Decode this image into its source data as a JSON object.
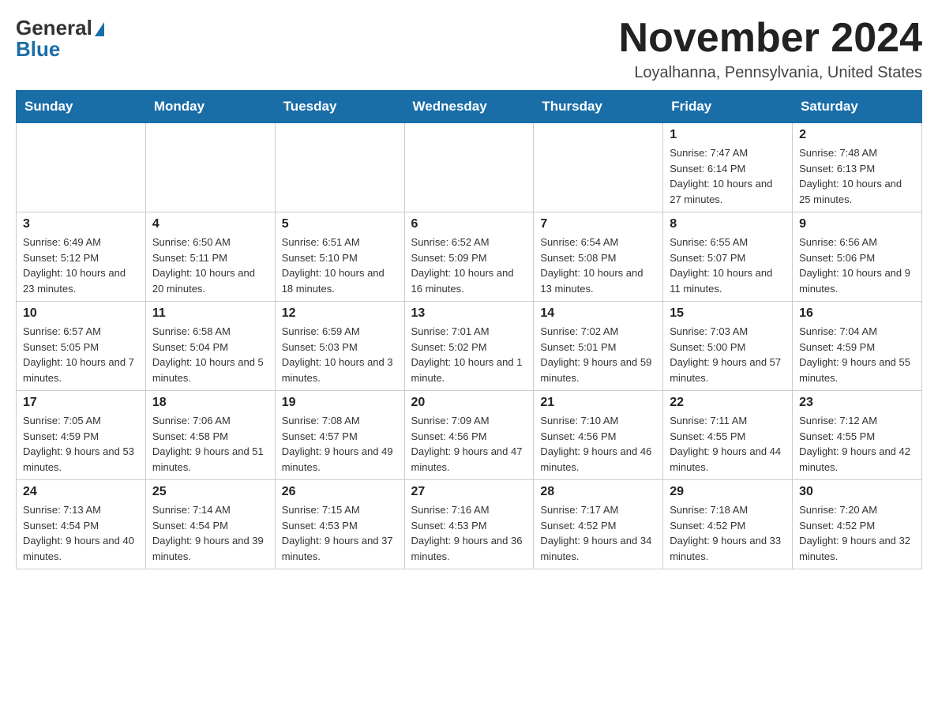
{
  "logo": {
    "general": "General",
    "blue": "Blue"
  },
  "title": "November 2024",
  "location": "Loyalhanna, Pennsylvania, United States",
  "days_of_week": [
    "Sunday",
    "Monday",
    "Tuesday",
    "Wednesday",
    "Thursday",
    "Friday",
    "Saturday"
  ],
  "weeks": [
    [
      {
        "day": "",
        "info": ""
      },
      {
        "day": "",
        "info": ""
      },
      {
        "day": "",
        "info": ""
      },
      {
        "day": "",
        "info": ""
      },
      {
        "day": "",
        "info": ""
      },
      {
        "day": "1",
        "info": "Sunrise: 7:47 AM\nSunset: 6:14 PM\nDaylight: 10 hours and 27 minutes."
      },
      {
        "day": "2",
        "info": "Sunrise: 7:48 AM\nSunset: 6:13 PM\nDaylight: 10 hours and 25 minutes."
      }
    ],
    [
      {
        "day": "3",
        "info": "Sunrise: 6:49 AM\nSunset: 5:12 PM\nDaylight: 10 hours and 23 minutes."
      },
      {
        "day": "4",
        "info": "Sunrise: 6:50 AM\nSunset: 5:11 PM\nDaylight: 10 hours and 20 minutes."
      },
      {
        "day": "5",
        "info": "Sunrise: 6:51 AM\nSunset: 5:10 PM\nDaylight: 10 hours and 18 minutes."
      },
      {
        "day": "6",
        "info": "Sunrise: 6:52 AM\nSunset: 5:09 PM\nDaylight: 10 hours and 16 minutes."
      },
      {
        "day": "7",
        "info": "Sunrise: 6:54 AM\nSunset: 5:08 PM\nDaylight: 10 hours and 13 minutes."
      },
      {
        "day": "8",
        "info": "Sunrise: 6:55 AM\nSunset: 5:07 PM\nDaylight: 10 hours and 11 minutes."
      },
      {
        "day": "9",
        "info": "Sunrise: 6:56 AM\nSunset: 5:06 PM\nDaylight: 10 hours and 9 minutes."
      }
    ],
    [
      {
        "day": "10",
        "info": "Sunrise: 6:57 AM\nSunset: 5:05 PM\nDaylight: 10 hours and 7 minutes."
      },
      {
        "day": "11",
        "info": "Sunrise: 6:58 AM\nSunset: 5:04 PM\nDaylight: 10 hours and 5 minutes."
      },
      {
        "day": "12",
        "info": "Sunrise: 6:59 AM\nSunset: 5:03 PM\nDaylight: 10 hours and 3 minutes."
      },
      {
        "day": "13",
        "info": "Sunrise: 7:01 AM\nSunset: 5:02 PM\nDaylight: 10 hours and 1 minute."
      },
      {
        "day": "14",
        "info": "Sunrise: 7:02 AM\nSunset: 5:01 PM\nDaylight: 9 hours and 59 minutes."
      },
      {
        "day": "15",
        "info": "Sunrise: 7:03 AM\nSunset: 5:00 PM\nDaylight: 9 hours and 57 minutes."
      },
      {
        "day": "16",
        "info": "Sunrise: 7:04 AM\nSunset: 4:59 PM\nDaylight: 9 hours and 55 minutes."
      }
    ],
    [
      {
        "day": "17",
        "info": "Sunrise: 7:05 AM\nSunset: 4:59 PM\nDaylight: 9 hours and 53 minutes."
      },
      {
        "day": "18",
        "info": "Sunrise: 7:06 AM\nSunset: 4:58 PM\nDaylight: 9 hours and 51 minutes."
      },
      {
        "day": "19",
        "info": "Sunrise: 7:08 AM\nSunset: 4:57 PM\nDaylight: 9 hours and 49 minutes."
      },
      {
        "day": "20",
        "info": "Sunrise: 7:09 AM\nSunset: 4:56 PM\nDaylight: 9 hours and 47 minutes."
      },
      {
        "day": "21",
        "info": "Sunrise: 7:10 AM\nSunset: 4:56 PM\nDaylight: 9 hours and 46 minutes."
      },
      {
        "day": "22",
        "info": "Sunrise: 7:11 AM\nSunset: 4:55 PM\nDaylight: 9 hours and 44 minutes."
      },
      {
        "day": "23",
        "info": "Sunrise: 7:12 AM\nSunset: 4:55 PM\nDaylight: 9 hours and 42 minutes."
      }
    ],
    [
      {
        "day": "24",
        "info": "Sunrise: 7:13 AM\nSunset: 4:54 PM\nDaylight: 9 hours and 40 minutes."
      },
      {
        "day": "25",
        "info": "Sunrise: 7:14 AM\nSunset: 4:54 PM\nDaylight: 9 hours and 39 minutes."
      },
      {
        "day": "26",
        "info": "Sunrise: 7:15 AM\nSunset: 4:53 PM\nDaylight: 9 hours and 37 minutes."
      },
      {
        "day": "27",
        "info": "Sunrise: 7:16 AM\nSunset: 4:53 PM\nDaylight: 9 hours and 36 minutes."
      },
      {
        "day": "28",
        "info": "Sunrise: 7:17 AM\nSunset: 4:52 PM\nDaylight: 9 hours and 34 minutes."
      },
      {
        "day": "29",
        "info": "Sunrise: 7:18 AM\nSunset: 4:52 PM\nDaylight: 9 hours and 33 minutes."
      },
      {
        "day": "30",
        "info": "Sunrise: 7:20 AM\nSunset: 4:52 PM\nDaylight: 9 hours and 32 minutes."
      }
    ]
  ]
}
